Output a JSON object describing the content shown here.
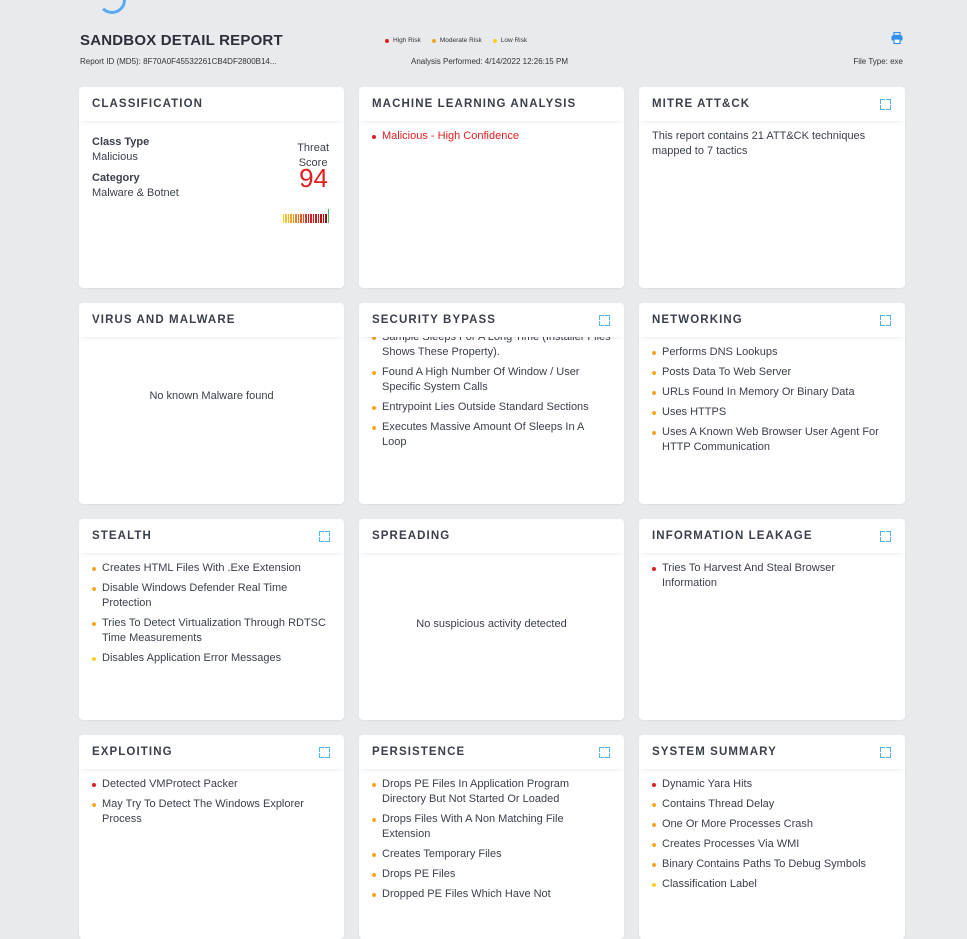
{
  "header": {
    "title": "SANDBOX DETAIL REPORT",
    "legend": [
      {
        "label": "High Risk",
        "color": "#e02020"
      },
      {
        "label": "Moderate Risk",
        "color": "#f5a623"
      },
      {
        "label": "Low Risk",
        "color": "#f8d020"
      }
    ],
    "report_id": "Report ID (MD5): 8F70A0F45532261CB4DF2800B14...",
    "analysis": "Analysis Performed: 4/14/2022 12:26:15 PM",
    "file_type": "File Type: exe",
    "print_icon": "printer-icon"
  },
  "colors": {
    "high": "#e02020",
    "moderate": "#f5a623",
    "low": "#f8d020",
    "accent": "#4db6e6"
  },
  "classification": {
    "title": "CLASSIFICATION",
    "class_type_label": "Class Type",
    "class_type_value": "Malicious",
    "category_label": "Category",
    "category_value": "Malware & Botnet",
    "threat_label_1": "Threat",
    "threat_label_2": "Score",
    "score": "94"
  },
  "ml": {
    "title": "MACHINE LEARNING ANALYSIS",
    "item": "Malicious - High Confidence"
  },
  "mitre": {
    "title": "MITRE ATT&CK",
    "text": "This report contains 21 ATT&CK techniques mapped to 7 tactics"
  },
  "virus": {
    "title": "VIRUS AND MALWARE",
    "message": "No known Malware found"
  },
  "security_bypass": {
    "title": "SECURITY BYPASS",
    "items": [
      {
        "text": "Sample Sleeps For A Long Time (Installer Files Shows These Property).",
        "risk": "moderate"
      },
      {
        "text": "Found A High Number Of Window / User Specific System Calls",
        "risk": "moderate"
      },
      {
        "text": "Entrypoint Lies Outside Standard Sections",
        "risk": "moderate"
      },
      {
        "text": "Executes Massive Amount Of Sleeps In A Loop",
        "risk": "moderate"
      }
    ]
  },
  "networking": {
    "title": "NETWORKING",
    "items": [
      {
        "text": "Performs DNS Lookups",
        "risk": "moderate"
      },
      {
        "text": "Posts Data To Web Server",
        "risk": "moderate"
      },
      {
        "text": "URLs Found In Memory Or Binary Data",
        "risk": "moderate"
      },
      {
        "text": "Uses HTTPS",
        "risk": "moderate"
      },
      {
        "text": "Uses A Known Web Browser User Agent For HTTP Communication",
        "risk": "moderate"
      }
    ]
  },
  "stealth": {
    "title": "STEALTH",
    "items": [
      {
        "text": "Creates HTML Files With .Exe Extension",
        "risk": "moderate"
      },
      {
        "text": "Disable Windows Defender Real Time Protection",
        "risk": "moderate"
      },
      {
        "text": "Tries To Detect Virtualization Through RDTSC Time Measurements",
        "risk": "moderate"
      },
      {
        "text": "Disables Application Error Messages",
        "risk": "low"
      }
    ]
  },
  "spreading": {
    "title": "SPREADING",
    "message": "No suspicious activity detected"
  },
  "leakage": {
    "title": "INFORMATION LEAKAGE",
    "items": [
      {
        "text": "Tries To Harvest And Steal Browser Information",
        "risk": "high"
      }
    ]
  },
  "exploiting": {
    "title": "EXPLOITING",
    "items": [
      {
        "text": "Detected VMProtect Packer",
        "risk": "high"
      },
      {
        "text": "May Try To Detect The Windows Explorer Process",
        "risk": "moderate"
      }
    ]
  },
  "persistence": {
    "title": "PERSISTENCE",
    "items": [
      {
        "text": "Drops PE Files In Application Program Directory But Not Started Or Loaded",
        "risk": "moderate"
      },
      {
        "text": "Drops Files With A Non Matching File Extension",
        "risk": "moderate"
      },
      {
        "text": "Creates Temporary Files",
        "risk": "moderate"
      },
      {
        "text": "Drops PE Files",
        "risk": "moderate"
      },
      {
        "text": "Dropped PE Files Which Have Not",
        "risk": "moderate"
      }
    ]
  },
  "system_summary": {
    "title": "SYSTEM SUMMARY",
    "items": [
      {
        "text": "Dynamic Yara Hits",
        "risk": "high"
      },
      {
        "text": "Contains Thread Delay",
        "risk": "moderate"
      },
      {
        "text": "One Or More Processes Crash",
        "risk": "moderate"
      },
      {
        "text": "Creates Processes Via WMI",
        "risk": "moderate"
      },
      {
        "text": "Binary Contains Paths To Debug Symbols",
        "risk": "moderate"
      },
      {
        "text": "Classification Label",
        "risk": "low"
      }
    ]
  }
}
